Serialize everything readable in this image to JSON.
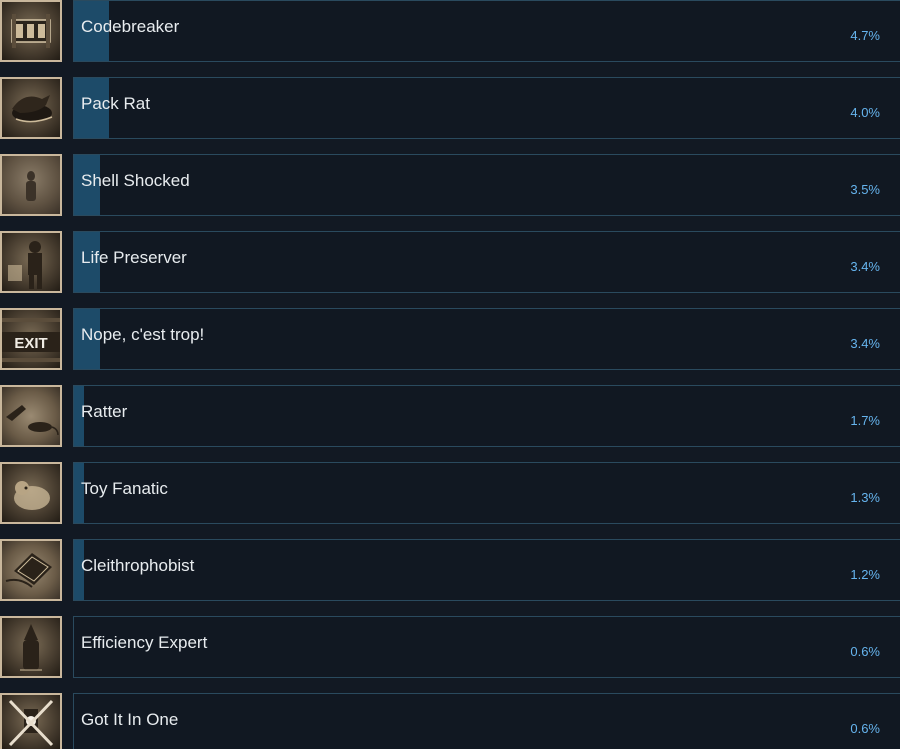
{
  "achievements": [
    {
      "name": "Codebreaker",
      "percent": "4.7%",
      "icon": "lock-dial-icon"
    },
    {
      "name": "Pack Rat",
      "percent": "4.0%",
      "icon": "rat-pile-icon"
    },
    {
      "name": "Shell Shocked",
      "percent": "3.5%",
      "icon": "shadow-figure-icon"
    },
    {
      "name": "Life Preserver",
      "percent": "3.4%",
      "icon": "soldier-icon"
    },
    {
      "name": "Nope, c'est trop!",
      "percent": "3.4%",
      "icon": "exit-sign-icon"
    },
    {
      "name": "Ratter",
      "percent": "1.7%",
      "icon": "rat-hand-icon"
    },
    {
      "name": "Toy Fanatic",
      "percent": "1.3%",
      "icon": "toy-bear-icon"
    },
    {
      "name": "Cleithrophobist",
      "percent": "1.2%",
      "icon": "trapdoor-icon"
    },
    {
      "name": "Efficiency Expert",
      "percent": "0.6%",
      "icon": "hooded-figure-icon"
    },
    {
      "name": "Got It In One",
      "percent": "0.6%",
      "icon": "crossed-lantern-icon"
    }
  ],
  "colors": {
    "background": "#121923",
    "bar_fill": "#1d4b69",
    "percent_text": "#66b4ee",
    "name_text": "#e8ecef"
  }
}
